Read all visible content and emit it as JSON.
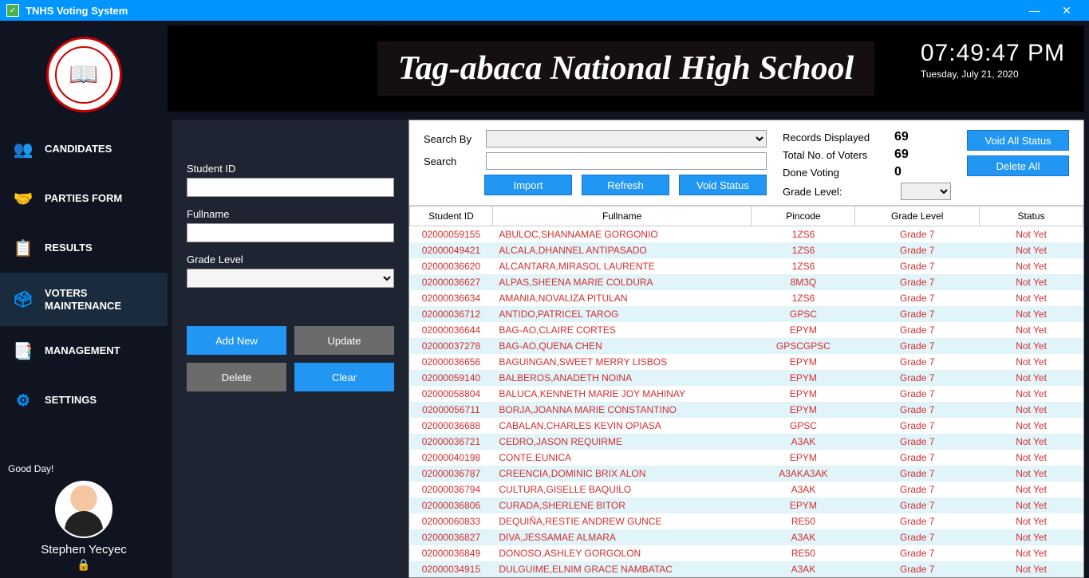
{
  "titlebar": {
    "app_name": "TNHS Voting System"
  },
  "sidebar": {
    "items": [
      {
        "label": "CANDIDATES"
      },
      {
        "label": "PARTIES FORM"
      },
      {
        "label": "RESULTS"
      },
      {
        "label": "VOTERS MAINTENANCE"
      },
      {
        "label": "MANAGEMENT"
      },
      {
        "label": "SETTINGS"
      }
    ],
    "greeting": "Good Day!",
    "username": "Stephen Yecyec"
  },
  "banner": {
    "school_name": "Tag-abaca National High School",
    "time": "07:49:47 PM",
    "date": "Tuesday, July 21, 2020"
  },
  "form": {
    "student_id_label": "Student ID",
    "fullname_label": "Fullname",
    "grade_level_label": "Grade Level",
    "add_new": "Add New",
    "update": "Update",
    "delete": "Delete",
    "clear": "Clear"
  },
  "search": {
    "search_by_label": "Search By",
    "search_label": "Search",
    "import": "Import",
    "refresh": "Refresh",
    "void_status": "Void Status"
  },
  "stats": {
    "records_displayed_label": "Records Displayed",
    "records_displayed": "69",
    "total_voters_label": "Total No. of Voters",
    "total_voters": "69",
    "done_voting_label": "Done Voting",
    "done_voting": "0",
    "grade_level_label": "Grade Level:"
  },
  "side_buttons": {
    "void_all": "Void All Status",
    "delete_all": "Delete All"
  },
  "columns": [
    "Student ID",
    "Fullname",
    "Pincode",
    "Grade Level",
    "Status"
  ],
  "rows": [
    {
      "id": "02000059155",
      "name": "ABULOC,SHANNAMAE GORGONIO",
      "pin": "1ZS6",
      "grade": "Grade 7",
      "status": "Not Yet"
    },
    {
      "id": "02000049421",
      "name": "ALCALA,DHANNEL ANTIPASADO",
      "pin": "1ZS6",
      "grade": "Grade 7",
      "status": "Not Yet"
    },
    {
      "id": "02000036620",
      "name": "ALCANTARA,MIRASOL LAURENTE",
      "pin": "1ZS6",
      "grade": "Grade 7",
      "status": "Not Yet"
    },
    {
      "id": "02000036627",
      "name": "ALPAS,SHEENA MARIE COLDURA",
      "pin": "8M3Q",
      "grade": "Grade 7",
      "status": "Not Yet"
    },
    {
      "id": "02000036634",
      "name": "AMANIA,NOVALIZA PITULAN",
      "pin": "1ZS6",
      "grade": "Grade 7",
      "status": "Not Yet"
    },
    {
      "id": "02000036712",
      "name": "ANTIDO,PATRICEL TAROG",
      "pin": "GPSC",
      "grade": "Grade 7",
      "status": "Not Yet"
    },
    {
      "id": "02000036644",
      "name": "BAG-AO,CLAIRE CORTES",
      "pin": "EPYM",
      "grade": "Grade 7",
      "status": "Not Yet"
    },
    {
      "id": "02000037278",
      "name": "BAG-AO,QUENA CHEN",
      "pin": "GPSCGPSC",
      "grade": "Grade 7",
      "status": "Not Yet"
    },
    {
      "id": "02000036656",
      "name": "BAGUINGAN,SWEET MERRY LISBOS",
      "pin": "EPYM",
      "grade": "Grade 7",
      "status": "Not Yet"
    },
    {
      "id": "02000059140",
      "name": "BALBEROS,ANADETH NOINA",
      "pin": "EPYM",
      "grade": "Grade 7",
      "status": "Not Yet"
    },
    {
      "id": "02000058804",
      "name": "BALUCA,KENNETH MARIE JOY MAHINAY",
      "pin": "EPYM",
      "grade": "Grade 7",
      "status": "Not Yet"
    },
    {
      "id": "02000056711",
      "name": "BORJA,JOANNA MARIE CONSTANTINO",
      "pin": "EPYM",
      "grade": "Grade 7",
      "status": "Not Yet"
    },
    {
      "id": "02000036688",
      "name": "CABALAN,CHARLES KEVIN OPIASA",
      "pin": "GPSC",
      "grade": "Grade 7",
      "status": "Not Yet"
    },
    {
      "id": "02000036721",
      "name": "CEDRO,JASON REQUIRME",
      "pin": "A3AK",
      "grade": "Grade 7",
      "status": "Not Yet"
    },
    {
      "id": "02000040198",
      "name": "CONTE,EUNICA",
      "pin": "EPYM",
      "grade": "Grade 7",
      "status": "Not Yet"
    },
    {
      "id": "02000036787",
      "name": "CREENCIA,DOMINIC BRIX ALON",
      "pin": "A3AKA3AK",
      "grade": "Grade 7",
      "status": "Not Yet"
    },
    {
      "id": "02000036794",
      "name": "CULTURA,GISELLE BAQUILO",
      "pin": "A3AK",
      "grade": "Grade 7",
      "status": "Not Yet"
    },
    {
      "id": "02000036806",
      "name": "CURADA,SHERLENE BITOR",
      "pin": "EPYM",
      "grade": "Grade 7",
      "status": "Not Yet"
    },
    {
      "id": "02000060833",
      "name": "DEQUIÑA,RESTIE ANDREW GUNCE",
      "pin": "RE50",
      "grade": "Grade 7",
      "status": "Not Yet"
    },
    {
      "id": "02000036827",
      "name": "DIVA,JESSAMAE ALMARA",
      "pin": "A3AK",
      "grade": "Grade 7",
      "status": "Not Yet"
    },
    {
      "id": "02000036849",
      "name": "DONOSO,ASHLEY GORGOLON",
      "pin": "RE50",
      "grade": "Grade 7",
      "status": "Not Yet"
    },
    {
      "id": "02000034915",
      "name": "DULGUIME,ELNIM GRACE NAMBATAC",
      "pin": "A3AK",
      "grade": "Grade 7",
      "status": "Not Yet"
    }
  ]
}
